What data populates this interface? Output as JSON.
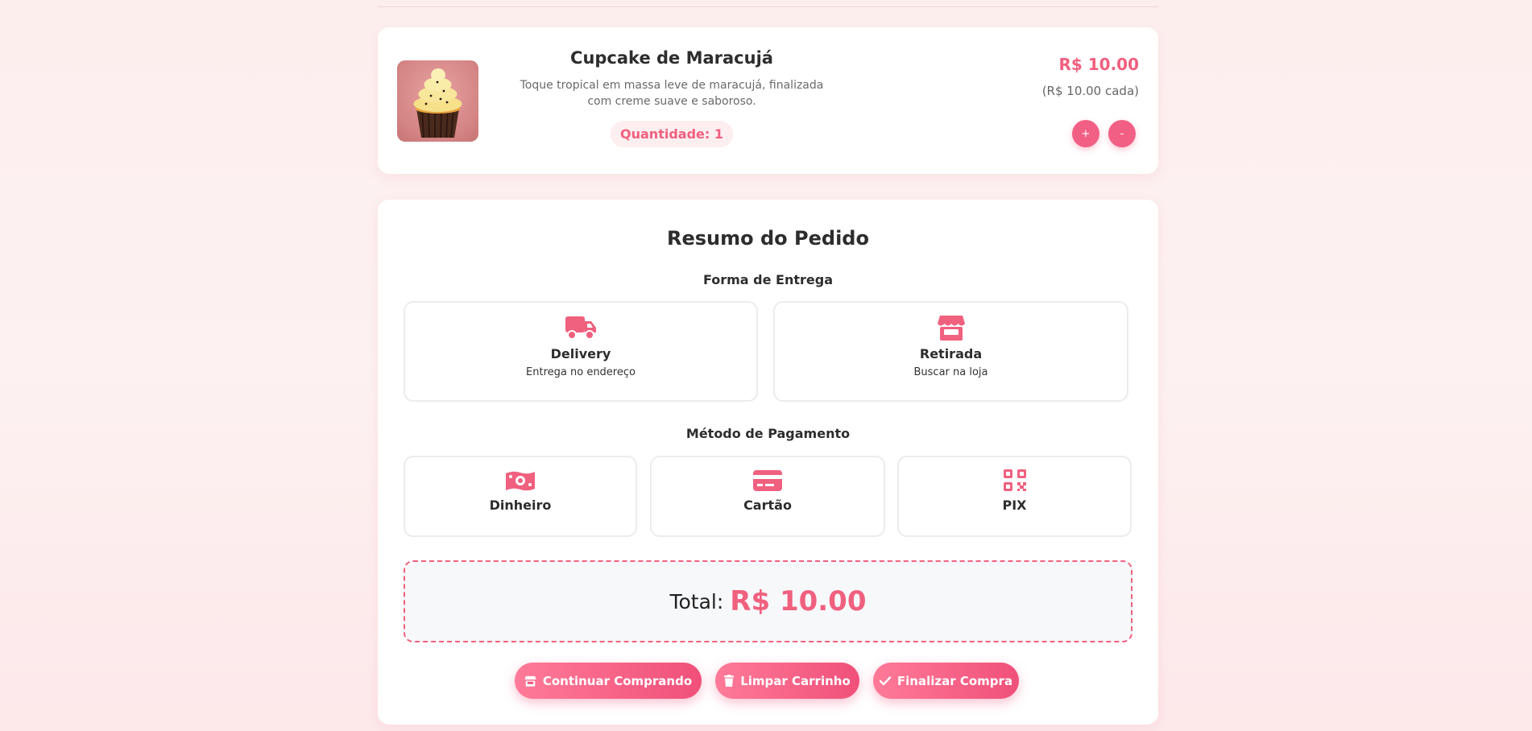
{
  "cart_item": {
    "name": "Cupcake de Maracujá",
    "description": "Toque tropical em massa leve de maracujá, finalizada com creme suave e saboroso.",
    "quantity_label": "Quantidade: 1",
    "price": "R$ 10.00",
    "unit_price": "(R$ 10.00 cada)",
    "plus_label": "+",
    "minus_label": "-"
  },
  "summary": {
    "title": "Resumo do Pedido",
    "delivery_title": "Forma de Entrega",
    "delivery_options": [
      {
        "name": "Delivery",
        "sub": "Entrega no endereço",
        "icon": "truck-icon"
      },
      {
        "name": "Retirada",
        "sub": "Buscar na loja",
        "icon": "store-icon"
      }
    ],
    "payment_title": "Método de Pagamento",
    "payment_options": [
      {
        "name": "Dinheiro",
        "icon": "cash-icon"
      },
      {
        "name": "Cartão",
        "icon": "credit-card-icon"
      },
      {
        "name": "PIX",
        "icon": "qrcode-icon"
      }
    ],
    "total_label": "Total:",
    "total_value": "R$ 10.00"
  },
  "actions": {
    "continue": "Continuar Comprando",
    "clear": "Limpar Carrinho",
    "checkout": "Finalizar Compra"
  },
  "colors": {
    "accent": "#f0607f",
    "button": "#f25f85",
    "background": "#fdeeee"
  }
}
